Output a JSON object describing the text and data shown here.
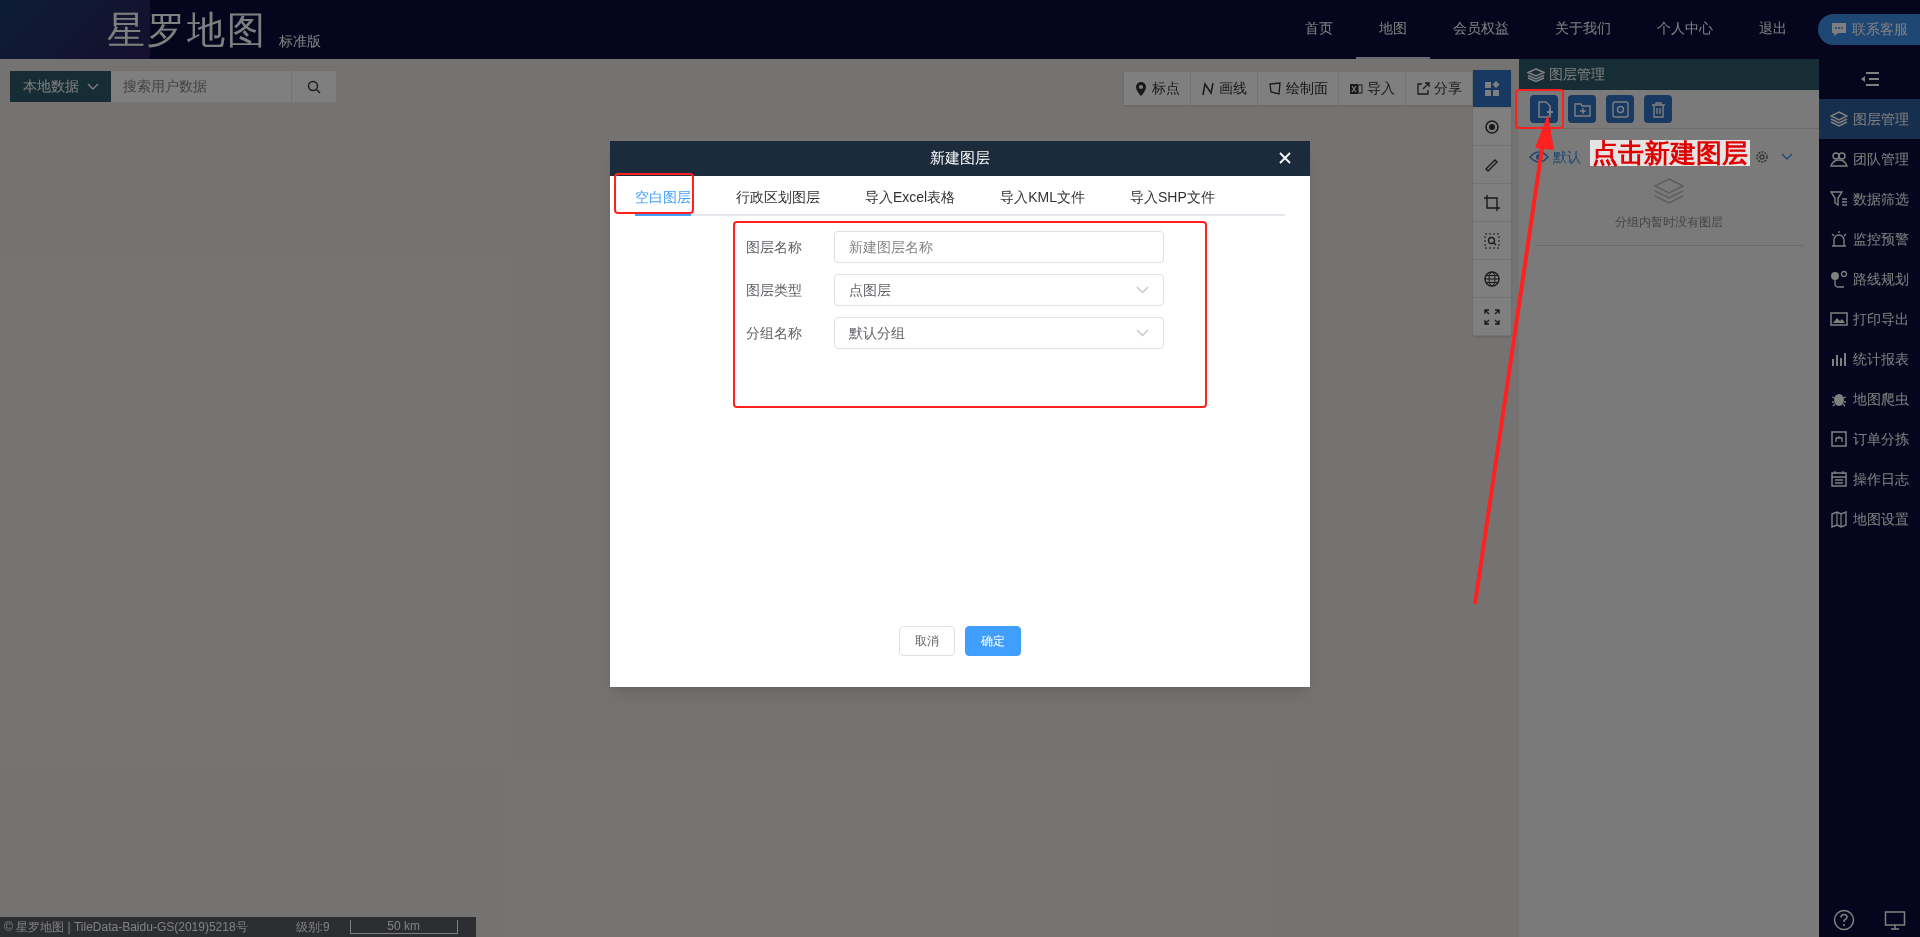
{
  "header": {
    "title": "星罗地图",
    "edition": "标准版",
    "contact_button": "联系客服",
    "nav": [
      {
        "label": "首页",
        "selected": false
      },
      {
        "label": "地图",
        "selected": true
      },
      {
        "label": "会员权益",
        "selected": false
      },
      {
        "label": "关于我们",
        "selected": false
      },
      {
        "label": "个人中心",
        "selected": false
      },
      {
        "label": "退出",
        "selected": false
      }
    ]
  },
  "search": {
    "source": "本地数据",
    "placeholder": "搜索用户数据"
  },
  "map_toolbar": [
    {
      "label": "标点"
    },
    {
      "label": "画线"
    },
    {
      "label": "绘制面"
    },
    {
      "label": "导入"
    },
    {
      "label": "分享"
    }
  ],
  "map_tools": [
    {
      "selected": true
    },
    {
      "selected": false
    },
    {
      "selected": false
    },
    {
      "selected": false
    },
    {
      "selected": false
    },
    {
      "selected": false
    },
    {
      "selected": false
    }
  ],
  "layer_panel": {
    "title": "图层管理",
    "group_label": "默认",
    "empty_text": "分组内暂时没有图层"
  },
  "sidebar": {
    "items": [
      {
        "label": "图层管理",
        "selected": true
      },
      {
        "label": "团队管理",
        "selected": false
      },
      {
        "label": "数据筛选",
        "selected": false
      },
      {
        "label": "监控预警",
        "selected": false
      },
      {
        "label": "路线规划",
        "selected": false
      },
      {
        "label": "打印导出",
        "selected": false
      },
      {
        "label": "统计报表",
        "selected": false
      },
      {
        "label": "地图爬虫",
        "selected": false
      },
      {
        "label": "订单分拣",
        "selected": false
      },
      {
        "label": "操作日志",
        "selected": false
      },
      {
        "label": "地图设置",
        "selected": false
      }
    ]
  },
  "dialog": {
    "title": "新建图层",
    "tabs": [
      {
        "label": "空白图层",
        "selected": true
      },
      {
        "label": "行政区划图层",
        "selected": false
      },
      {
        "label": "导入Excel表格",
        "selected": false
      },
      {
        "label": "导入KML文件",
        "selected": false
      },
      {
        "label": "导入SHP文件",
        "selected": false
      }
    ],
    "fields": [
      {
        "label": "图层名称",
        "kind": "text",
        "placeholder": "新建图层名称"
      },
      {
        "label": "图层类型",
        "kind": "select",
        "value": "点图层"
      },
      {
        "label": "分组名称",
        "kind": "select",
        "value": "默认分组"
      }
    ],
    "buttons": [
      {
        "label": "取消",
        "kind": "secondary"
      },
      {
        "label": "确定",
        "kind": "primary"
      }
    ]
  },
  "annotation": {
    "text": "点击新建图层"
  },
  "status_bar": {
    "attribution": "© 星罗地图 | TileData-Baidu-GS(2019)5218号",
    "zoom_level": "级别:9",
    "scale": "50 km"
  }
}
